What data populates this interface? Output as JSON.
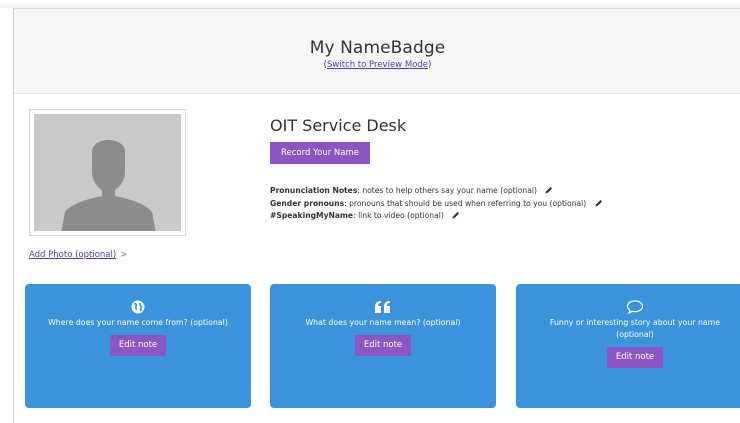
{
  "header": {
    "title": "My NameBadge",
    "sub_prefix": "(",
    "switch_link": "Switch to Preview Mode",
    "sub_suffix": ")"
  },
  "profile": {
    "name": "OIT Service Desk",
    "record_button": "Record Your Name",
    "add_photo_link": "Add Photo (optional)",
    "add_photo_chevron": ">"
  },
  "notes": [
    {
      "label": "Pronunciation Notes",
      "text": ": notes to help others say your name (optional)"
    },
    {
      "label": "Gender pronouns",
      "text": ": pronouns that should be used when referring to you (optional)"
    },
    {
      "label": "#SpeakingMyName",
      "text": ": link to video (optional)"
    }
  ],
  "cards": [
    {
      "icon": "globe-icon",
      "question": "Where does your name come from? (optional)",
      "button": "Edit note"
    },
    {
      "icon": "quote-icon",
      "question": "What does your name mean? (optional)",
      "button": "Edit note"
    },
    {
      "icon": "speech-bubble-icon",
      "question": "Funny or interesting story about your name (optional)",
      "button": "Edit note"
    }
  ],
  "colors": {
    "card_blue": "#3b93dc",
    "button_purple": "#8b56c2",
    "link_purple": "#4b3fb5"
  }
}
